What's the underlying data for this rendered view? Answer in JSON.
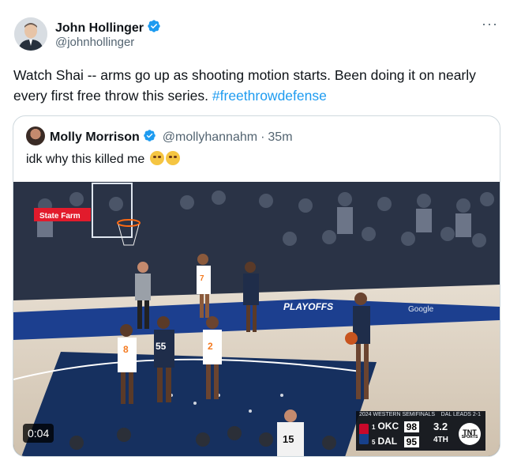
{
  "author": {
    "name": "John Hollinger",
    "handle": "@johnhollinger",
    "verified": true,
    "verified_color": "#1d9bf0"
  },
  "more_label": "···",
  "tweet": {
    "text": "Watch Shai -- arms go up as shooting motion starts. Been doing it on nearly every first free throw this series. ",
    "hashtag": "#freethrowdefense",
    "hashtag_color": "#1d9bf0"
  },
  "quoted": {
    "name": "Molly Morrison",
    "handle": "@mollyhannahm",
    "separator": "·",
    "time": "35m",
    "verified": true,
    "text": "idk why this killed me",
    "emoji": [
      "loudly-crying-face",
      "loudly-crying-face"
    ]
  },
  "video": {
    "duration_badge": "0:04",
    "sponsor_sign": "State Farm",
    "court_text": "PLAYOFFS",
    "court_brand": "Google",
    "players": [
      {
        "team": "home",
        "number": "7"
      },
      {
        "team": "home",
        "number": "8"
      },
      {
        "team": "home",
        "number": "2"
      },
      {
        "team": "away",
        "number": "55"
      },
      {
        "team": "ref",
        "number": "15"
      }
    ],
    "scorebug": {
      "series_title": "2024 WESTERN SEMIFINALS",
      "series_status": "DAL LEADS 2-1",
      "teams": [
        {
          "seed": "1",
          "abbr": "OKC",
          "score": "98"
        },
        {
          "seed": "5",
          "abbr": "DAL",
          "score": "95"
        }
      ],
      "clock": "3.2",
      "period": "4TH",
      "network": "TNT",
      "network_sub": "SPORTS"
    }
  }
}
